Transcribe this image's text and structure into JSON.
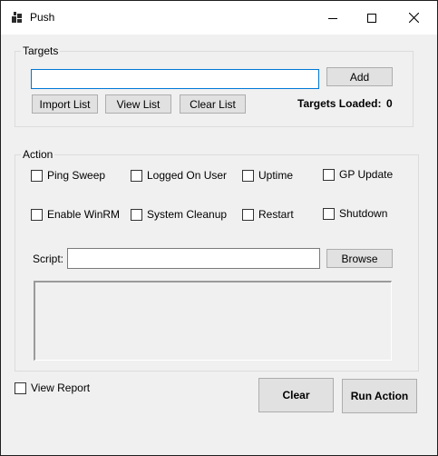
{
  "window": {
    "title": "Push",
    "icon": "app-window-icon",
    "controls": {
      "minimize": "minimize-icon",
      "maximize": "maximize-icon",
      "close": "close-icon"
    }
  },
  "targets": {
    "group_label": "Targets",
    "input_value": "",
    "add_label": "Add",
    "import_label": "Import List",
    "view_label": "View List",
    "clear_label": "Clear List",
    "loaded_label": "Targets Loaded:",
    "loaded_count": "0"
  },
  "action": {
    "group_label": "Action",
    "options": [
      {
        "label": "Ping Sweep",
        "checked": false
      },
      {
        "label": "Logged On User",
        "checked": false
      },
      {
        "label": "Uptime",
        "checked": false
      },
      {
        "label": "GP Update",
        "checked": false
      },
      {
        "label": "Enable WinRM",
        "checked": false
      },
      {
        "label": "System Cleanup",
        "checked": false
      },
      {
        "label": "Restart",
        "checked": false
      },
      {
        "label": "Shutdown",
        "checked": false
      }
    ],
    "script_label": "Script:",
    "script_value": "",
    "browse_label": "Browse"
  },
  "footer": {
    "view_report_label": "View Report",
    "view_report_checked": false,
    "clear_label": "Clear",
    "run_label": "Run Action"
  }
}
